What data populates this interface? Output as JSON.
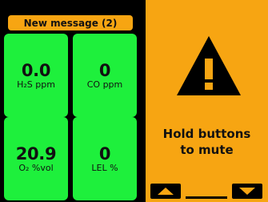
{
  "colors": {
    "tile_green": "#1ef03c",
    "alert_orange": "#f7a512",
    "background": "#000000",
    "text_dark": "#111111"
  },
  "message_bar": {
    "label": "New message (2)"
  },
  "readings": [
    {
      "value": "0.0",
      "unit": "H₂S ppm"
    },
    {
      "value": "0",
      "unit": "CO ppm"
    },
    {
      "value": "20.9",
      "unit": "O₂ %vol"
    },
    {
      "value": "0",
      "unit": "LEL %"
    }
  ],
  "alert": {
    "icon": "warning-triangle-icon",
    "text_line1": "Hold buttons",
    "text_line2": "to mute"
  },
  "softkeys": {
    "left_icon": "triangle-up-icon",
    "right_icon": "triangle-down-icon"
  }
}
